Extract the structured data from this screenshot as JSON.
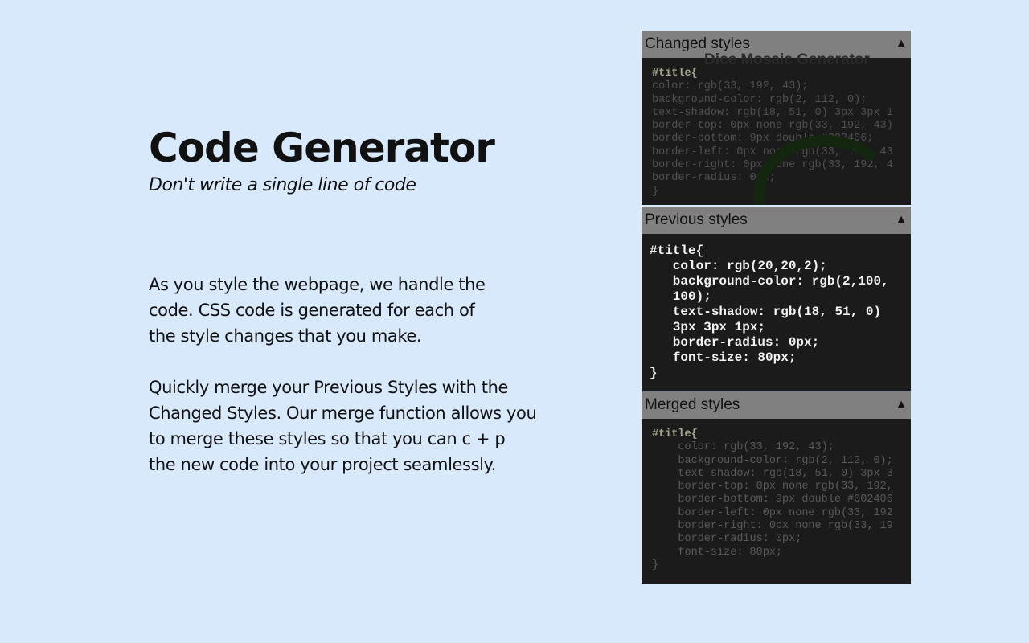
{
  "hero": {
    "title": "Code Generator",
    "subtitle": "Don't write a single line of code"
  },
  "description": {
    "p1_lines": [
      "As you style the webpage, we handle the",
      "code. CSS code is generated for each of",
      "the style changes that you make."
    ],
    "p2_lines": [
      "Quickly merge your Previous Styles with the",
      "Changed Styles. Our merge function allows you",
      "to merge these styles so that you can c + p",
      "the new code into your project seamlessly."
    ]
  },
  "panels": {
    "changed": {
      "title": "Changed styles",
      "toggle": "▲",
      "bg_text": "Dice Mosaic Generator",
      "selector": "#title{",
      "lines": [
        "color: rgb(33, 192, 43);",
        "background-color: rgb(2, 112, 0);",
        "text-shadow: rgb(18, 51, 0) 3px 3px 1",
        "border-top: 0px none rgb(33, 192, 43)",
        "border-bottom: 9px double #002406;",
        "border-left: 0px none rgb(33, 192, 43",
        "border-right: 0px none rgb(33, 192, 4",
        "border-radius: 0px;",
        "}"
      ]
    },
    "previous": {
      "title": "Previous styles",
      "toggle": "▲",
      "lines": [
        "#title{",
        "   color: rgb(20,20,2);",
        "   background-color: rgb(2,100,",
        "   100);",
        "   text-shadow: rgb(18, 51, 0)",
        "   3px 3px 1px;",
        "   border-radius: 0px;",
        "   font-size: 80px;",
        "}"
      ]
    },
    "merged": {
      "title": "Merged styles",
      "toggle": "▲",
      "selector": "#title{",
      "lines": [
        "    color: rgb(33, 192, 43);",
        "    background-color: rgb(2, 112, 0);",
        "    text-shadow: rgb(18, 51, 0) 3px 3",
        "    border-top: 0px none rgb(33, 192,",
        "    border-bottom: 9px double #002406",
        "    border-left: 0px none rgb(33, 192",
        "    border-right: 0px none rgb(33, 19",
        "    border-radius: 0px;",
        "    font-size: 80px;",
        "}"
      ]
    }
  }
}
